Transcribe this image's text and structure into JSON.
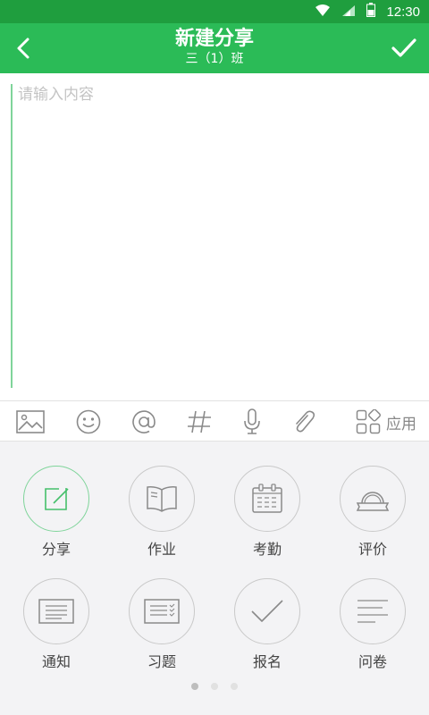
{
  "status": {
    "time": "12:30"
  },
  "header": {
    "title": "新建分享",
    "subtitle": "三（1）班"
  },
  "editor": {
    "placeholder": "请输入内容",
    "value": ""
  },
  "toolbar": {
    "tools": [
      {
        "icon": "image-icon"
      },
      {
        "icon": "emoji-icon"
      },
      {
        "icon": "at-icon"
      },
      {
        "icon": "hashtag-icon"
      },
      {
        "icon": "microphone-icon"
      },
      {
        "icon": "attachment-icon"
      }
    ],
    "apps_label": "应用"
  },
  "panel": {
    "items": [
      {
        "label": "分享",
        "icon": "share-edit-icon",
        "active": true
      },
      {
        "label": "作业",
        "icon": "book-icon"
      },
      {
        "label": "考勤",
        "icon": "calendar-icon"
      },
      {
        "label": "评价",
        "icon": "badge-icon"
      },
      {
        "label": "通知",
        "icon": "notice-icon"
      },
      {
        "label": "习题",
        "icon": "exercise-icon"
      },
      {
        "label": "报名",
        "icon": "check-icon"
      },
      {
        "label": "问卷",
        "icon": "survey-icon"
      }
    ],
    "pages": 3,
    "current_page": 1
  },
  "colors": {
    "statusbar": "#1f9e3e",
    "titlebar": "#2bbb57",
    "accent": "#7fd49a"
  }
}
